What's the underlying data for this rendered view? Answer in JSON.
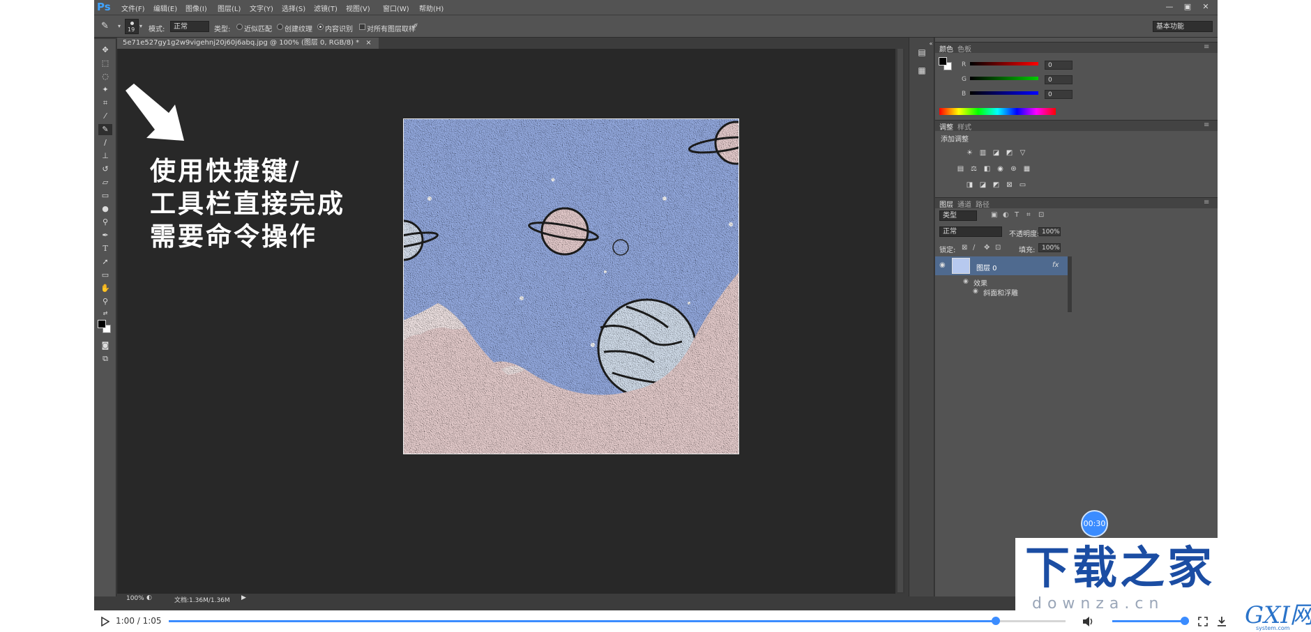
{
  "app": {
    "logo": "Ps"
  },
  "menu": [
    "文件(F)",
    "编辑(E)",
    "图像(I)",
    "图层(L)",
    "文字(Y)",
    "选择(S)",
    "滤镜(T)",
    "视图(V)",
    "窗口(W)",
    "帮助(H)"
  ],
  "window_controls": {
    "minimize": "—",
    "maximize": "▣",
    "close": "✕"
  },
  "options_bar": {
    "brush_size": "19",
    "mode_label": "模式:",
    "mode_value": "正常",
    "type_label": "类型:",
    "radio_1": "近似匹配",
    "radio_2": "创建纹理",
    "radio_3": "内容识别",
    "sample_all": "对所有图层取样",
    "workspace": "基本功能"
  },
  "document": {
    "tab_title": "5e71e527gy1g2w9vigehnj20j60j6abq.jpg @ 100% (图层 0, RGB/8) *",
    "tab_close": "×"
  },
  "status_bar": {
    "zoom": "100%",
    "doc_info": "文档:1.36M/1.36M"
  },
  "color_panel": {
    "tabs": [
      "颜色",
      "色板"
    ],
    "r_label": "R",
    "r_value": "0",
    "g_label": "G",
    "g_value": "0",
    "b_label": "B",
    "b_value": "0"
  },
  "adjust_panel": {
    "tabs": [
      "调整",
      "样式"
    ],
    "heading": "添加调整"
  },
  "layers_panel": {
    "tabs": [
      "图层",
      "通道",
      "路径"
    ],
    "filter_kind": "类型",
    "blend_mode": "正常",
    "opacity_label": "不透明度:",
    "opacity_value": "100%",
    "lock_label": "锁定:",
    "fill_label": "填充:",
    "fill_value": "100%",
    "layer_name": "图层 0",
    "fx_badge": "fx",
    "effects_label": "效果",
    "effect_item": "斜面和浮雕"
  },
  "overlay": {
    "caption_lines": [
      "使用快捷键/",
      "工具栏直接完成",
      "需要命令操作"
    ],
    "timer": "00:30",
    "watermark_title": "下载之家",
    "watermark_sub": "downza.cn",
    "site_logo": "GXI网",
    "site_sub": "system.com"
  },
  "player": {
    "time": "1:00 / 1:05",
    "progress": 0.922,
    "volume": 1.0
  }
}
